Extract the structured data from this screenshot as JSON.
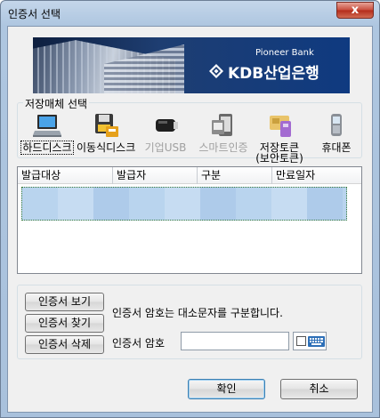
{
  "window": {
    "title": "인증서 선택",
    "close_label": "x"
  },
  "banner": {
    "subtitle": "Pioneer Bank",
    "brand": "KDB산업은행"
  },
  "storage": {
    "legend": "저장매체 선택",
    "devices": [
      {
        "label": "하드디스크",
        "icon": "laptop-icon",
        "state": "selected"
      },
      {
        "label": "이동식디스크",
        "icon": "removable-disk-icon",
        "state": "enabled"
      },
      {
        "label": "기업USB",
        "icon": "usb-token-icon",
        "state": "disabled"
      },
      {
        "label": "스마트인증",
        "icon": "smart-auth-icon",
        "state": "disabled"
      },
      {
        "label": "저장토큰\n(보안토큰)",
        "icon": "security-token-icon",
        "state": "enabled"
      },
      {
        "label": "휴대폰",
        "icon": "mobile-phone-icon",
        "state": "enabled"
      }
    ]
  },
  "cert_list": {
    "columns": [
      "발급대상",
      "발급자",
      "구분",
      "만료일자"
    ]
  },
  "actions": {
    "view": "인증서 보기",
    "find": "인증서 찾기",
    "delete": "인증서 삭제",
    "hint": "인증서 암호는 대소문자를 구분합니다.",
    "password_label": "인증서 암호",
    "password_value": "",
    "keyboard_icon": "keyboard-icon"
  },
  "footer": {
    "ok": "확인",
    "cancel": "취소"
  },
  "colors": {
    "selection": "#b9d4ee",
    "banner_bg": "#1e3e72",
    "close_button": "#c84b3a"
  }
}
